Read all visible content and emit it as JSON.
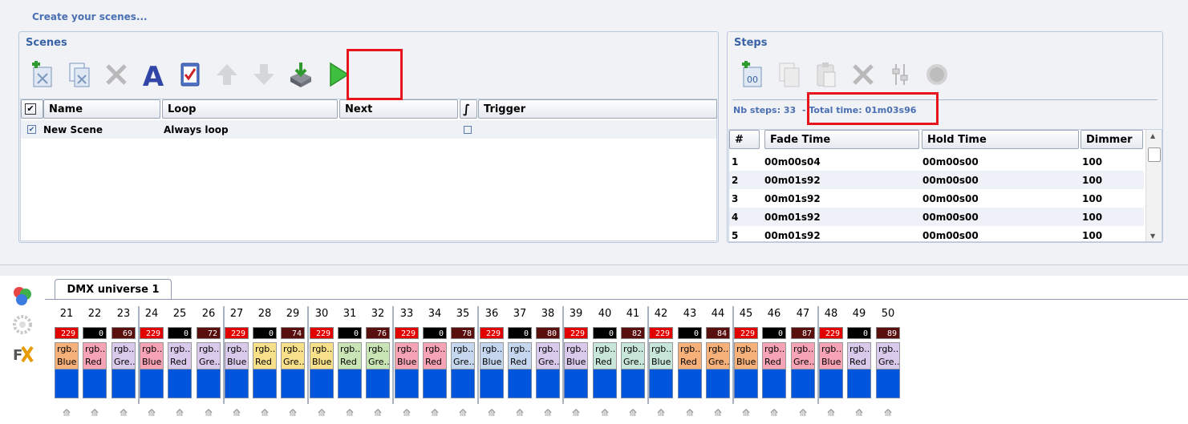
{
  "header": {
    "link_text": "Create your scenes..."
  },
  "scenes": {
    "title": "Scenes",
    "toolbar": [
      {
        "name": "add-scene-icon",
        "enabled": true
      },
      {
        "name": "copy-scene-icon",
        "enabled": true
      },
      {
        "name": "delete-scene-icon",
        "enabled": false
      },
      {
        "name": "rename-scene-icon",
        "enabled": true
      },
      {
        "name": "checklist-icon",
        "enabled": true
      },
      {
        "name": "move-up-icon",
        "enabled": false
      },
      {
        "name": "move-down-icon",
        "enabled": false
      },
      {
        "name": "import-icon",
        "enabled": true
      },
      {
        "name": "play-icon",
        "enabled": true
      }
    ],
    "columns": {
      "name": "Name",
      "loop": "Loop",
      "next": "Next",
      "trigger": "Trigger"
    },
    "rows": [
      {
        "name": "New Scene",
        "loop": "Always loop",
        "next": "",
        "checked": true,
        "trigger": false
      }
    ]
  },
  "steps": {
    "title": "Steps",
    "nb_steps": "Nb steps: 33",
    "total_time": "- Total time: 01m03s96",
    "columns": {
      "index": "#",
      "fade": "Fade Time",
      "hold": "Hold Time",
      "dimmer": "Dimmer"
    },
    "rows": [
      {
        "index": "1",
        "fade": "00m00s04",
        "hold": "00m00s00",
        "dimmer": "100"
      },
      {
        "index": "2",
        "fade": "00m01s92",
        "hold": "00m00s00",
        "dimmer": "100"
      },
      {
        "index": "3",
        "fade": "00m01s92",
        "hold": "00m00s00",
        "dimmer": "100"
      },
      {
        "index": "4",
        "fade": "00m01s92",
        "hold": "00m00s00",
        "dimmer": "100"
      },
      {
        "index": "5",
        "fade": "00m01s92",
        "hold": "00m00s00",
        "dimmer": "100"
      }
    ]
  },
  "dmx": {
    "tab_label": "DMX universe 1",
    "channels": [
      {
        "num": "21",
        "value": "229",
        "val_color": "#e30000",
        "name1": "rgb...",
        "name2": "Blue",
        "name_color": "#f6b07a"
      },
      {
        "num": "22",
        "value": "0",
        "val_color": "#000000",
        "name1": "rgb...",
        "name2": "Red",
        "name_color": "#f6a3b5"
      },
      {
        "num": "23",
        "value": "69",
        "val_color": "#5a0f0f",
        "name1": "rgb...",
        "name2": "Gre...",
        "name_color": "#d9c9eb"
      },
      {
        "num": "24",
        "value": "229",
        "val_color": "#e30000",
        "name1": "rgb...",
        "name2": "Blue",
        "name_color": "#f6a3b5"
      },
      {
        "num": "25",
        "value": "0",
        "val_color": "#000000",
        "name1": "rgb...",
        "name2": "Red",
        "name_color": "#d9c9eb"
      },
      {
        "num": "26",
        "value": "72",
        "val_color": "#5a0f0f",
        "name1": "rgb...",
        "name2": "Gre...",
        "name_color": "#d9c9eb"
      },
      {
        "num": "27",
        "value": "229",
        "val_color": "#e30000",
        "name1": "rgb...",
        "name2": "Blue",
        "name_color": "#d9c9eb"
      },
      {
        "num": "28",
        "value": "0",
        "val_color": "#000000",
        "name1": "rgb...",
        "name2": "Red",
        "name_color": "#f7e089"
      },
      {
        "num": "29",
        "value": "74",
        "val_color": "#5a0f0f",
        "name1": "rgb...",
        "name2": "Gre...",
        "name_color": "#f7e089"
      },
      {
        "num": "30",
        "value": "229",
        "val_color": "#e30000",
        "name1": "rgb...",
        "name2": "Blue",
        "name_color": "#f7e089"
      },
      {
        "num": "31",
        "value": "0",
        "val_color": "#000000",
        "name1": "rgb...",
        "name2": "Red",
        "name_color": "#c9e4b5"
      },
      {
        "num": "32",
        "value": "76",
        "val_color": "#5a0f0f",
        "name1": "rgb...",
        "name2": "Gre...",
        "name_color": "#c9e4b5"
      },
      {
        "num": "33",
        "value": "229",
        "val_color": "#e30000",
        "name1": "rgb...",
        "name2": "Blue",
        "name_color": "#f6a3b5"
      },
      {
        "num": "34",
        "value": "0",
        "val_color": "#000000",
        "name1": "rgb...",
        "name2": "Red",
        "name_color": "#f6a3b5"
      },
      {
        "num": "35",
        "value": "78",
        "val_color": "#5a0f0f",
        "name1": "rgb...",
        "name2": "Gre...",
        "name_color": "#c5d7ee"
      },
      {
        "num": "36",
        "value": "229",
        "val_color": "#e30000",
        "name1": "rgb...",
        "name2": "Blue",
        "name_color": "#c5d7ee"
      },
      {
        "num": "37",
        "value": "0",
        "val_color": "#000000",
        "name1": "rgb...",
        "name2": "Red",
        "name_color": "#c5d7ee"
      },
      {
        "num": "38",
        "value": "80",
        "val_color": "#5a0f0f",
        "name1": "rgb...",
        "name2": "Gre...",
        "name_color": "#d9c9eb"
      },
      {
        "num": "39",
        "value": "229",
        "val_color": "#e30000",
        "name1": "rgb...",
        "name2": "Blue",
        "name_color": "#d9c9eb"
      },
      {
        "num": "40",
        "value": "0",
        "val_color": "#000000",
        "name1": "rgb...",
        "name2": "Red",
        "name_color": "#c7e6d9"
      },
      {
        "num": "41",
        "value": "82",
        "val_color": "#5a0f0f",
        "name1": "rgb...",
        "name2": "Gre...",
        "name_color": "#c7e6d9"
      },
      {
        "num": "42",
        "value": "229",
        "val_color": "#e30000",
        "name1": "rgb...",
        "name2": "Blue",
        "name_color": "#c7e6d9"
      },
      {
        "num": "43",
        "value": "0",
        "val_color": "#000000",
        "name1": "rgb...",
        "name2": "Red",
        "name_color": "#f6b07a"
      },
      {
        "num": "44",
        "value": "84",
        "val_color": "#5a0f0f",
        "name1": "rgb...",
        "name2": "Gre...",
        "name_color": "#f6b07a"
      },
      {
        "num": "45",
        "value": "229",
        "val_color": "#e30000",
        "name1": "rgb...",
        "name2": "Blue",
        "name_color": "#f6b07a"
      },
      {
        "num": "46",
        "value": "0",
        "val_color": "#000000",
        "name1": "rgb...",
        "name2": "Red",
        "name_color": "#f6a3b5"
      },
      {
        "num": "47",
        "value": "87",
        "val_color": "#5a0f0f",
        "name1": "rgb...",
        "name2": "Gre...",
        "name_color": "#f6a3b5"
      },
      {
        "num": "48",
        "value": "229",
        "val_color": "#e30000",
        "name1": "rgb...",
        "name2": "Blue",
        "name_color": "#f6a3b5"
      },
      {
        "num": "49",
        "value": "0",
        "val_color": "#000000",
        "name1": "rgb...",
        "name2": "Red",
        "name_color": "#d9c9eb"
      },
      {
        "num": "50",
        "value": "89",
        "val_color": "#5a0f0f",
        "name1": "rgb...",
        "name2": "Gre...",
        "name_color": "#d9c9eb"
      }
    ]
  },
  "colors": {
    "accent": "#3a62a6",
    "highlight": "#e8141c",
    "fader_blue": "#0055dd"
  }
}
